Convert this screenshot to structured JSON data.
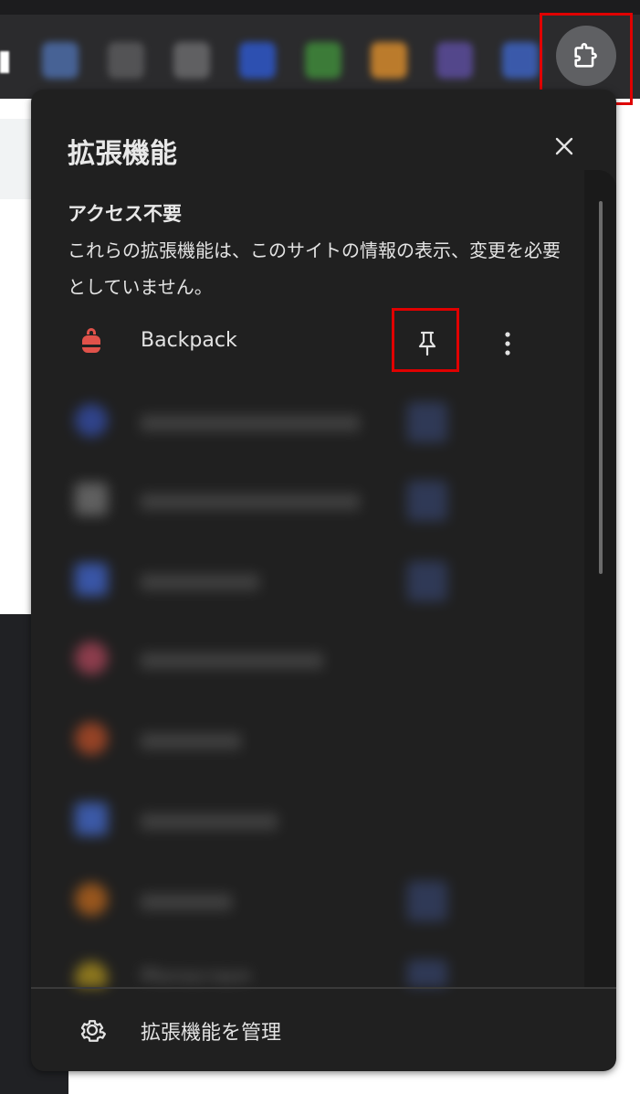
{
  "panel": {
    "title": "拡張機能",
    "close_label": "×",
    "section_heading": "アクセス不要",
    "section_desc": "これらの拡張機能は、このサイトの情報の表示、変更を必要としていません。"
  },
  "extensions": [
    {
      "name": "Backpack",
      "icon": "backpack-icon",
      "color": "#e0524a"
    },
    {
      "name": "",
      "icon": "blurred-extension-icon",
      "color": "#3b5bd1"
    },
    {
      "name": "",
      "icon": "blurred-extension-icon",
      "color": "#8a8a8a"
    },
    {
      "name": "",
      "icon": "blurred-extension-icon",
      "color": "#4a79ff"
    },
    {
      "name": "",
      "icon": "blurred-extension-icon",
      "color": "#d4506a"
    },
    {
      "name": "",
      "icon": "blurred-extension-icon",
      "color": "#e35a2a"
    },
    {
      "name": "",
      "icon": "blurred-extension-icon",
      "color": "#4e7fff"
    },
    {
      "name": "",
      "icon": "blurred-extension-icon",
      "color": "#e77a1c"
    },
    {
      "name": "Monocraon",
      "icon": "blurred-extension-icon",
      "color": "#d4b01c"
    }
  ],
  "footer": {
    "manage_label": "拡張機能を管理",
    "icon": "gear-icon"
  },
  "toolbar": {
    "extensions_button_icon": "puzzle-icon",
    "highlight_color": "#e00000"
  }
}
